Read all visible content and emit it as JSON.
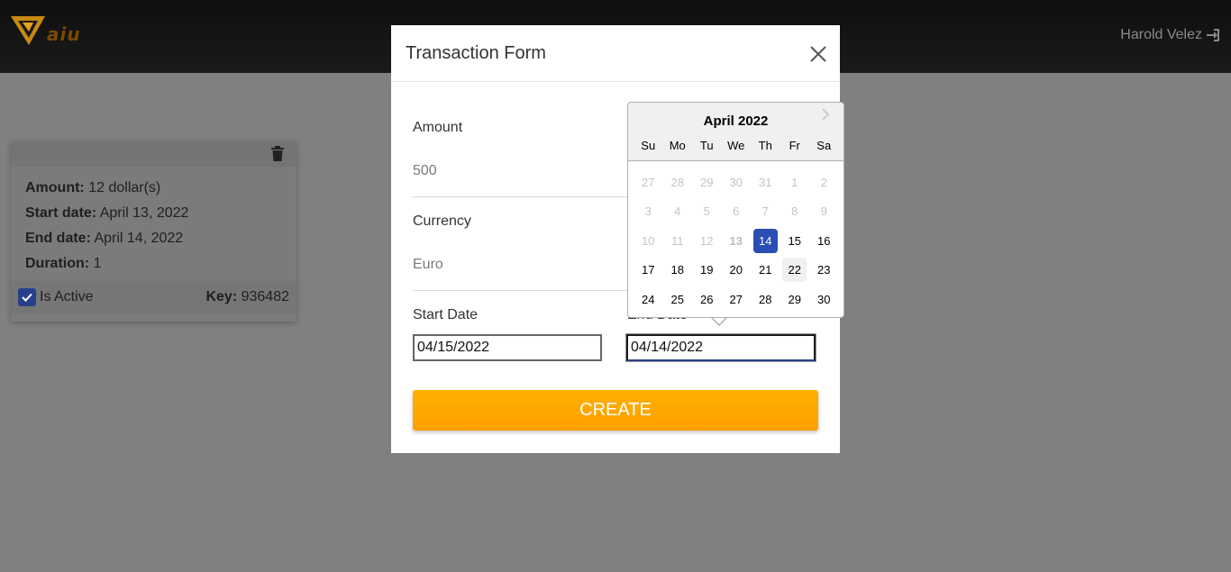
{
  "header": {
    "logo_text": "aiu",
    "user_name": "Harold Velez",
    "login_icon": "sign-in-icon",
    "accent_color": "#ff9f00"
  },
  "card": {
    "amount_label": "Amount:",
    "amount_value": "12 dollar(s)",
    "start_label": "Start date:",
    "start_value": "April 13, 2022",
    "end_label": "End date:",
    "end_value": "April 14, 2022",
    "duration_label": "Duration:",
    "duration_value": "1",
    "active_label": "Is Active",
    "key_label": "Key:",
    "key_value": "936482"
  },
  "modal": {
    "title": "Transaction Form",
    "amount_label": "Amount",
    "amount_value": "500",
    "currency_label": "Currency",
    "currency_value": "Euro",
    "start_date_label": "Start Date",
    "start_date_value": "04/15/2022",
    "end_date_label": "End Date",
    "end_date_value": "04/14/2022",
    "create_label": "CREATE"
  },
  "datepicker": {
    "month_label": "April 2022",
    "weekdays": [
      "Su",
      "Mo",
      "Tu",
      "We",
      "Th",
      "Fr",
      "Sa"
    ],
    "weeks": [
      [
        "27",
        "28",
        "29",
        "30",
        "31",
        "1",
        "2"
      ],
      [
        "3",
        "4",
        "5",
        "6",
        "7",
        "8",
        "9"
      ],
      [
        "10",
        "11",
        "12",
        "13",
        "14",
        "15",
        "16"
      ],
      [
        "17",
        "18",
        "19",
        "20",
        "21",
        "22",
        "23"
      ],
      [
        "24",
        "25",
        "26",
        "27",
        "28",
        "29",
        "30"
      ]
    ],
    "selected": "14",
    "today": "13",
    "hovered": "22",
    "selected_color": "#2a4eb3"
  }
}
